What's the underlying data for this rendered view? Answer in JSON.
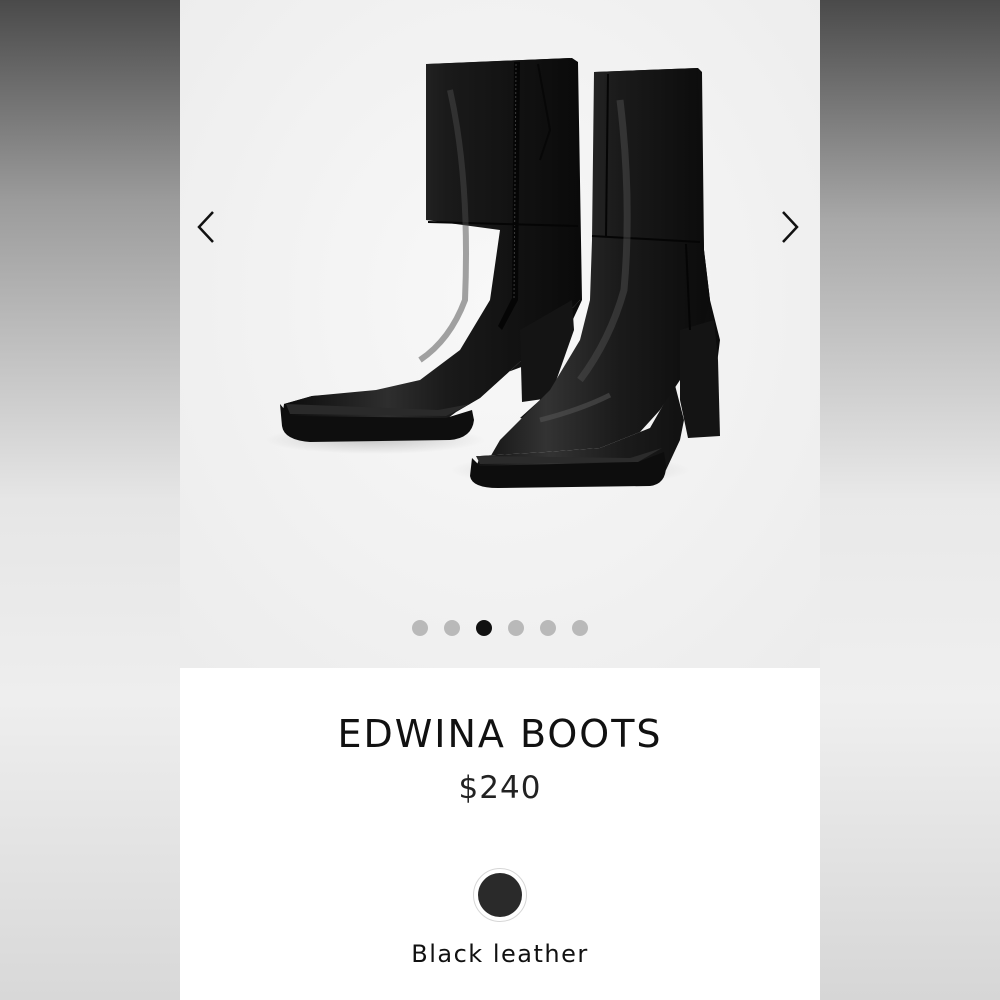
{
  "product": {
    "name": "EDWINA BOOTS",
    "price": "$240",
    "selected_color": "Black leather",
    "swatch_color": "#2a2a2a",
    "image_alt": "Edwina black leather boots"
  },
  "gallery": {
    "total_images": 6,
    "current_index": 3,
    "prev_icon": "chevron-left-icon",
    "next_icon": "chevron-right-icon"
  },
  "colors": {
    "page_bg": "#ffffff",
    "active_dot": "#111111",
    "inactive_dot": "#b9b9b9"
  }
}
